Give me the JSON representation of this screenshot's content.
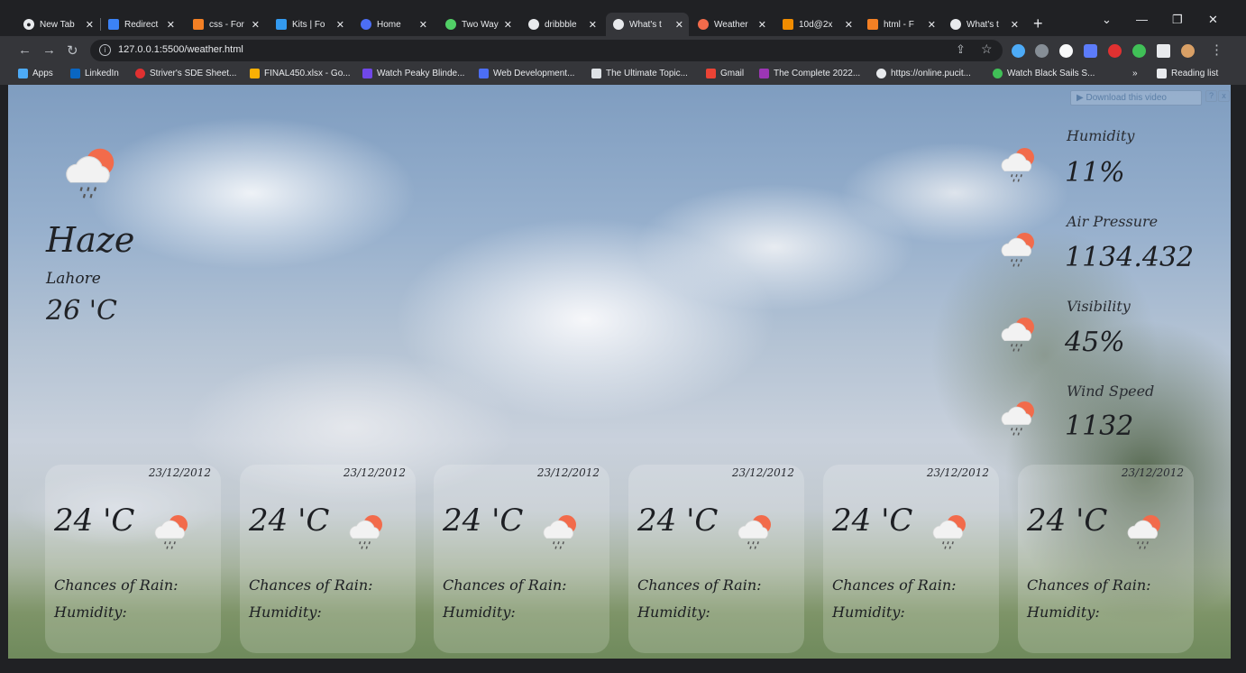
{
  "browser": {
    "tabs": [
      {
        "label": "New Tab"
      },
      {
        "label": "Redirect"
      },
      {
        "label": "css - For"
      },
      {
        "label": "Kits | Fo"
      },
      {
        "label": "Home"
      },
      {
        "label": "Two Way"
      },
      {
        "label": "dribbble"
      },
      {
        "label": "What's t"
      },
      {
        "label": "Weather"
      },
      {
        "label": "10d@2x"
      },
      {
        "label": "html - F"
      },
      {
        "label": "What's t"
      }
    ],
    "url": "127.0.0.1:5500/weather.html",
    "bookmarks": [
      {
        "label": "Apps"
      },
      {
        "label": "LinkedIn"
      },
      {
        "label": "Striver's SDE Sheet..."
      },
      {
        "label": "FINAL450.xlsx - Go..."
      },
      {
        "label": "Watch Peaky Blinde..."
      },
      {
        "label": "Web Development..."
      },
      {
        "label": "The Ultimate Topic..."
      },
      {
        "label": "Gmail"
      },
      {
        "label": "The Complete 2022..."
      },
      {
        "label": "https://online.pucit..."
      },
      {
        "label": "Watch Black Sails S..."
      }
    ],
    "reading_list": "Reading list",
    "more_bookmarks": "»"
  },
  "video_helper": {
    "label": "Download this video",
    "help": "?",
    "close": "x"
  },
  "weather": {
    "condition": "Haze",
    "city": "Lahore",
    "temperature": "26 'C",
    "stats": [
      {
        "label": "Humidity",
        "value": "11%"
      },
      {
        "label": "Air Pressure",
        "value": "1134.432"
      },
      {
        "label": "Visibility",
        "value": "45%"
      },
      {
        "label": "Wind Speed",
        "value": "1132"
      }
    ],
    "forecast": [
      {
        "date": "23/12/2012",
        "temp": "24 'C",
        "rain_label": "Chances of Rain:",
        "humidity_label": "Humidity:"
      },
      {
        "date": "23/12/2012",
        "temp": "24 'C",
        "rain_label": "Chances of Rain:",
        "humidity_label": "Humidity:"
      },
      {
        "date": "23/12/2012",
        "temp": "24 'C",
        "rain_label": "Chances of Rain:",
        "humidity_label": "Humidity:"
      },
      {
        "date": "23/12/2012",
        "temp": "24 'C",
        "rain_label": "Chances of Rain:",
        "humidity_label": "Humidity:"
      },
      {
        "date": "23/12/2012",
        "temp": "24 'C",
        "rain_label": "Chances of Rain:",
        "humidity_label": "Humidity:"
      },
      {
        "date": "23/12/2012",
        "temp": "24 'C",
        "rain_label": "Chances of Rain:",
        "humidity_label": "Humidity:"
      }
    ]
  },
  "icons": {
    "weather": "sun-cloud-rain-icon",
    "back": "back-arrow-icon",
    "forward": "forward-arrow-icon",
    "reload": "reload-icon",
    "star": "star-icon",
    "share": "share-icon",
    "info": "info-icon",
    "new_tab": "plus-icon"
  },
  "colors": {
    "sun": "#f26b4b",
    "cloud": "#f2f2f2",
    "text": "#1d1f23",
    "tab_strip": "#202124",
    "toolbar": "#35363a"
  }
}
